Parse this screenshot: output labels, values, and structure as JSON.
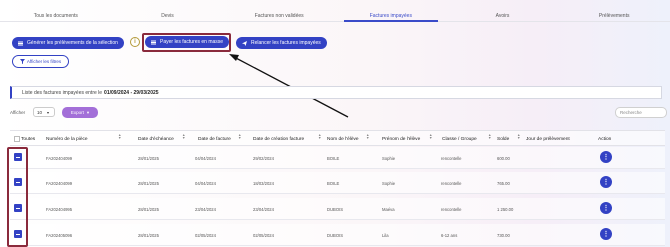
{
  "tabs": [
    "Tous les documents",
    "Devis",
    "Factures non validées",
    "Factures impayées",
    "Avoirs",
    "Prélèvements"
  ],
  "active_tab_index": 3,
  "actions": {
    "generate_label": "Générer les prélèvements de la sélection",
    "pay_label": "Payer les factures en masse",
    "remind_label": "Relancer les factures impayées",
    "filters_label": "Afficher les filtres",
    "info_glyph": "i"
  },
  "period": {
    "prefix": "Liste des factures impayées entre le",
    "range": "01/09/2024 - 29/03/2025"
  },
  "controls": {
    "show_label": "Afficher",
    "show_value": "10",
    "export_label": "Export",
    "search_placeholder": "Recherche"
  },
  "columns": [
    "Toutes",
    "Numéro de la pièce",
    "Date d'échéance",
    "Date de facture",
    "Date de création facture",
    "Nom de l'élève",
    "Prénom de l'élève",
    "Classe / Groupe",
    "Solde",
    "Jour de prélèvement",
    "Action"
  ],
  "rows": [
    {
      "piece": "FA202404099",
      "echeance": "28/01/2025",
      "facture": "04/04/2024",
      "creation": "29/02/2024",
      "nom": "BOILE",
      "prenom": "Sophie",
      "classe": "rencontelle",
      "solde": "600.00",
      "jour": ""
    },
    {
      "piece": "FA202404099",
      "echeance": "28/01/2025",
      "facture": "04/04/2024",
      "creation": "18/03/2024",
      "nom": "BOILE",
      "prenom": "Sophie",
      "classe": "rencontelle",
      "solde": "765.00",
      "jour": ""
    },
    {
      "piece": "FA202404995",
      "echeance": "28/01/2025",
      "facture": "23/04/2024",
      "creation": "23/04/2024",
      "nom": "DUBOIS",
      "prenom": "Maéva",
      "classe": "rencontelle",
      "solde": "1 250.00",
      "jour": ""
    },
    {
      "piece": "FA202405096",
      "echeance": "28/01/2025",
      "facture": "02/05/2024",
      "creation": "02/05/2024",
      "nom": "DUBOIS",
      "prenom": "Lila",
      "classe": "6-12 ans",
      "solde": "730.00",
      "jour": ""
    }
  ],
  "action_glyph": "⋮",
  "colors": {
    "primary": "#3342c4",
    "export": "#a36fd8",
    "annotation": "#8a2a3c"
  }
}
